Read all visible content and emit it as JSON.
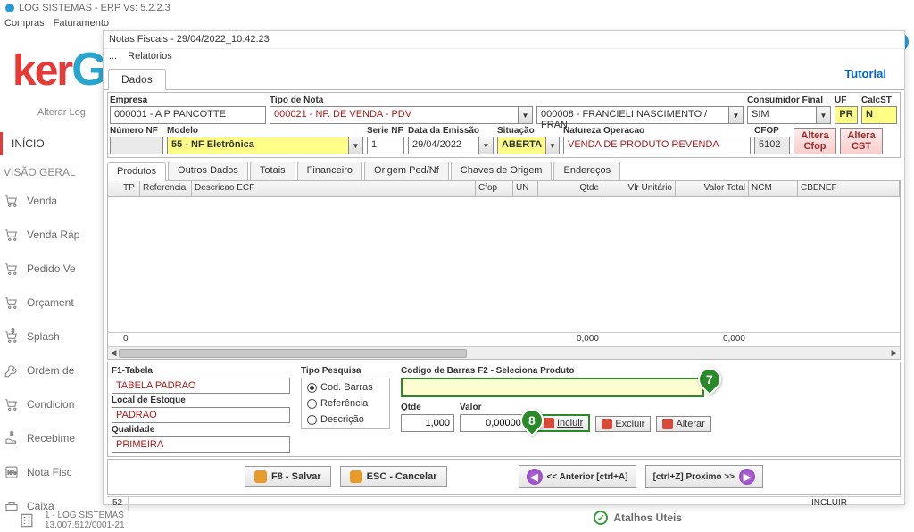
{
  "app": {
    "title": "LOG SISTEMAS - ERP Vs: 5.2.2.3"
  },
  "main_menu": {
    "items": [
      "Compras",
      "Faturamento"
    ]
  },
  "logo": {
    "part1": "ker",
    "part2": "G",
    "subtitle": "Alterar Log"
  },
  "sidebar": {
    "sections": [
      {
        "label": "INÍCIO",
        "active": true
      },
      {
        "label": "VISÃO GERAL"
      }
    ],
    "items": [
      {
        "label": "Venda"
      },
      {
        "label": "Venda Ráp"
      },
      {
        "label": "Pedido Ve"
      },
      {
        "label": "Orçament"
      },
      {
        "label": "Splash"
      },
      {
        "label": "Ordem de"
      },
      {
        "label": "Condicion"
      },
      {
        "label": "Recebime"
      },
      {
        "label": "Nota Fisc"
      },
      {
        "label": "Caixa"
      }
    ]
  },
  "modal": {
    "title": "Notas Fiscais - 29/04/2022_10:42:23",
    "menu": [
      "...",
      "Relatórios"
    ],
    "tutorial": "Tutorial",
    "dados_tab": "Dados",
    "header": {
      "empresa": {
        "label": "Empresa",
        "value": "000001 - A P PANCOTTE"
      },
      "tipo_nota": {
        "label": "Tipo de Nota",
        "value": "000021 - NF. DE VENDA - PDV"
      },
      "vendedor": {
        "value": "000008 - FRANCIELI NASCIMENTO / FRAN"
      },
      "cons_final": {
        "label": "Consumidor Final",
        "value": "SIM"
      },
      "uf": {
        "label": "UF",
        "value": "PR"
      },
      "calcst": {
        "label": "CalcST",
        "value": "N"
      },
      "numero_nf": {
        "label": "Número NF",
        "value": ""
      },
      "modelo": {
        "label": "Modelo",
        "value": "55 - NF Eletrônica"
      },
      "serie_nf": {
        "label": "Serie NF",
        "value": "1"
      },
      "data_emissao": {
        "label": "Data da Emissão",
        "value": "29/04/2022"
      },
      "situacao": {
        "label": "Situação",
        "value": "ABERTA"
      },
      "natureza": {
        "label": "Natureza Operacao",
        "value": "VENDA DE PRODUTO REVENDA"
      },
      "cfop": {
        "label": "CFOP",
        "value": "5102"
      },
      "altera_cfop": "Altera\nCfop",
      "altera_cst": "Altera\nCST"
    },
    "sub_tabs": [
      "Produtos",
      "Outros Dados",
      "Totais",
      "Financeiro",
      "Origem Ped/Nf",
      "Chaves de Origem",
      "Endereços"
    ],
    "grid": {
      "columns": [
        "TP",
        "Referencia",
        "Descricao ECF",
        "Cfop",
        "UN",
        "Qtde",
        "Vlr Unitário",
        "Valor Total",
        "NCM",
        "CBENEF"
      ],
      "footer": {
        "count": "0",
        "qtde": "0,000",
        "total": "0,000"
      }
    },
    "lower": {
      "f1_tabela": {
        "label": "F1-Tabela",
        "value": "TABELA PADRAO"
      },
      "local_estoque": {
        "label": "Local de Estoque",
        "value": "PADRAO"
      },
      "qualidade": {
        "label": "Qualidade",
        "value": "PRIMEIRA"
      },
      "tipo_pesquisa": {
        "label": "Tipo Pesquisa",
        "options": [
          "Cod. Barras",
          "Referência",
          "Descrição"
        ]
      },
      "barcode_label": "Codigo de Barras F2 - Seleciona Produto",
      "qtde": {
        "label": "Qtde",
        "value": "1,000"
      },
      "valor": {
        "label": "Valor",
        "value": "0,000000"
      },
      "btn_incluir": "Incluir",
      "btn_excluir": "Excluir",
      "btn_alterar": "Alterar"
    },
    "bottom": {
      "salvar": "F8 - Salvar",
      "cancelar": "ESC - Cancelar",
      "anterior": "<< Anterior [ctrl+A]",
      "proximo": "[ctrl+Z] Proximo >>"
    },
    "status": {
      "left": "52",
      "right": "INCLUIR"
    }
  },
  "callouts": {
    "c7": "7",
    "c8": "8"
  },
  "footer": {
    "company_line1": "1 - LOG SISTEMAS",
    "company_line2": "13.007.512/0001-21",
    "shortcut": "Atalhos Uteis"
  }
}
